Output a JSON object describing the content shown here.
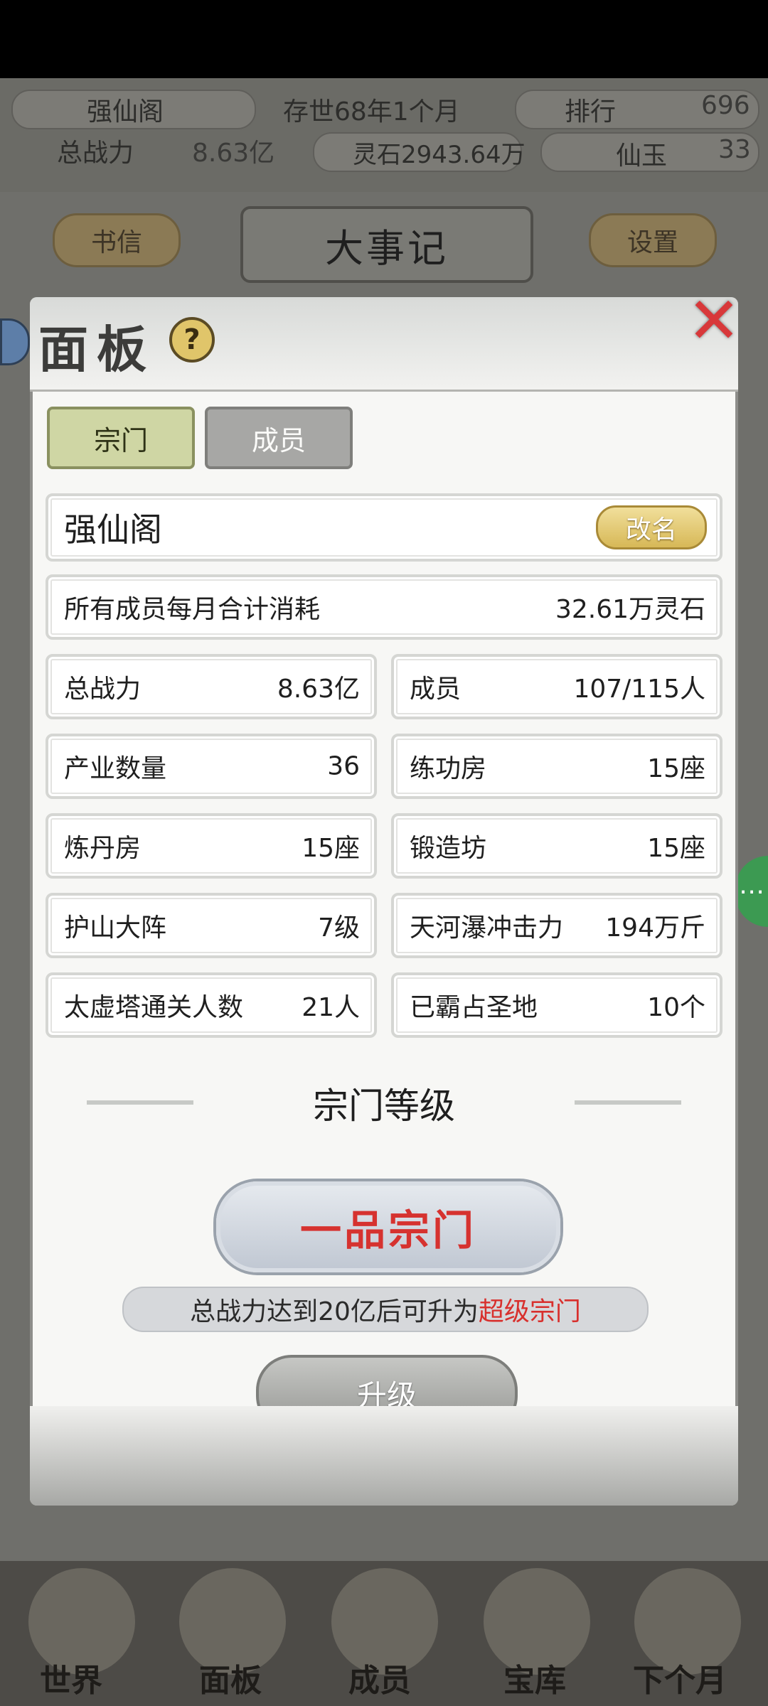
{
  "hud": {
    "sect_name": "强仙阁",
    "age": "存世68年1个月",
    "rank_label": "排行",
    "rank_value": "696",
    "power_label": "总战力",
    "power_value": "8.63亿",
    "spirit_stone": "灵石2943.64万",
    "jade_label": "仙玉",
    "jade_value": "33",
    "letters_button": "书信",
    "events_title": "大事记",
    "settings_button": "设置"
  },
  "panel": {
    "title": "面板",
    "help": "?",
    "close": "✕",
    "tabs": [
      {
        "label": "宗门",
        "active": true
      },
      {
        "label": "成员",
        "active": false
      }
    ],
    "name_field": {
      "value": "强仙阁",
      "rename_label": "改名"
    },
    "monthly_cost": {
      "label": "所有成员每月合计消耗",
      "value": "32.61万灵石"
    },
    "stats": [
      {
        "label": "总战力",
        "value": "8.63亿"
      },
      {
        "label": "成员",
        "value": "107/115人"
      },
      {
        "label": "产业数量",
        "value": "36"
      },
      {
        "label": "练功房",
        "value": "15座"
      },
      {
        "label": "炼丹房",
        "value": "15座"
      },
      {
        "label": "锻造坊",
        "value": "15座"
      },
      {
        "label": "护山大阵",
        "value": "7级"
      },
      {
        "label": "天河瀑冲击力",
        "value": "194万斤"
      },
      {
        "label": "太虚塔通关人数",
        "value": "21人"
      },
      {
        "label": "已霸占圣地",
        "value": "10个"
      }
    ],
    "level_section": "宗门等级",
    "level_badge": "一品宗门",
    "hint_prefix": "总战力达到20亿后可升为",
    "hint_highlight": "超级宗门",
    "upgrade_label": "升级"
  },
  "nav": {
    "items": [
      "世界",
      "面板",
      "成员",
      "宝库",
      "下个月"
    ]
  },
  "colors": {
    "accent_red": "#d6322f",
    "tab_active_bg": "#cfd6a4",
    "rename_gold": "#d7b857"
  }
}
